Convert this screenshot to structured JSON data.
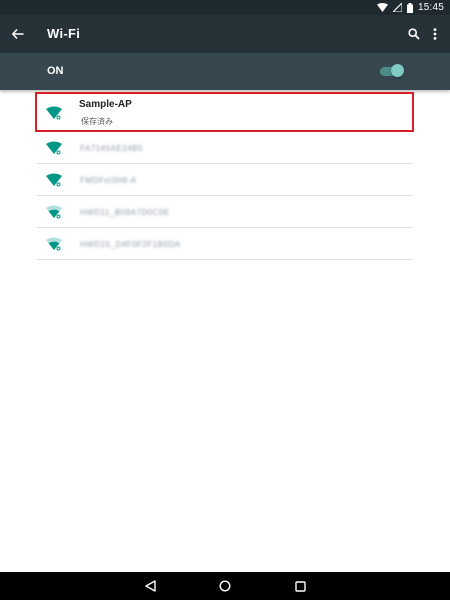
{
  "status_bar": {
    "time": "15:45"
  },
  "app_bar": {
    "title": "Wi-Fi"
  },
  "wifi_switch": {
    "label": "ON",
    "enabled": true
  },
  "networks": [
    {
      "name": "Sample-AP",
      "status": "保存済み",
      "signal": "full",
      "highlighted": true
    },
    {
      "name": "FA7145AE24B5",
      "status": "",
      "signal": "full",
      "highlighted": false
    },
    {
      "name": "FMDFxI3H8-A",
      "status": "",
      "signal": "full",
      "highlighted": false
    },
    {
      "name": "HWD11_B09A7D0C0E",
      "status": "",
      "signal": "medium",
      "highlighted": false
    },
    {
      "name": "HWD15_D4F0F2F1B0DA",
      "status": "",
      "signal": "medium",
      "highlighted": false
    }
  ],
  "colors": {
    "accent": "#009688",
    "highlight": "#d61f26",
    "app_bar": "#263238",
    "switch_bar": "#37474f"
  }
}
